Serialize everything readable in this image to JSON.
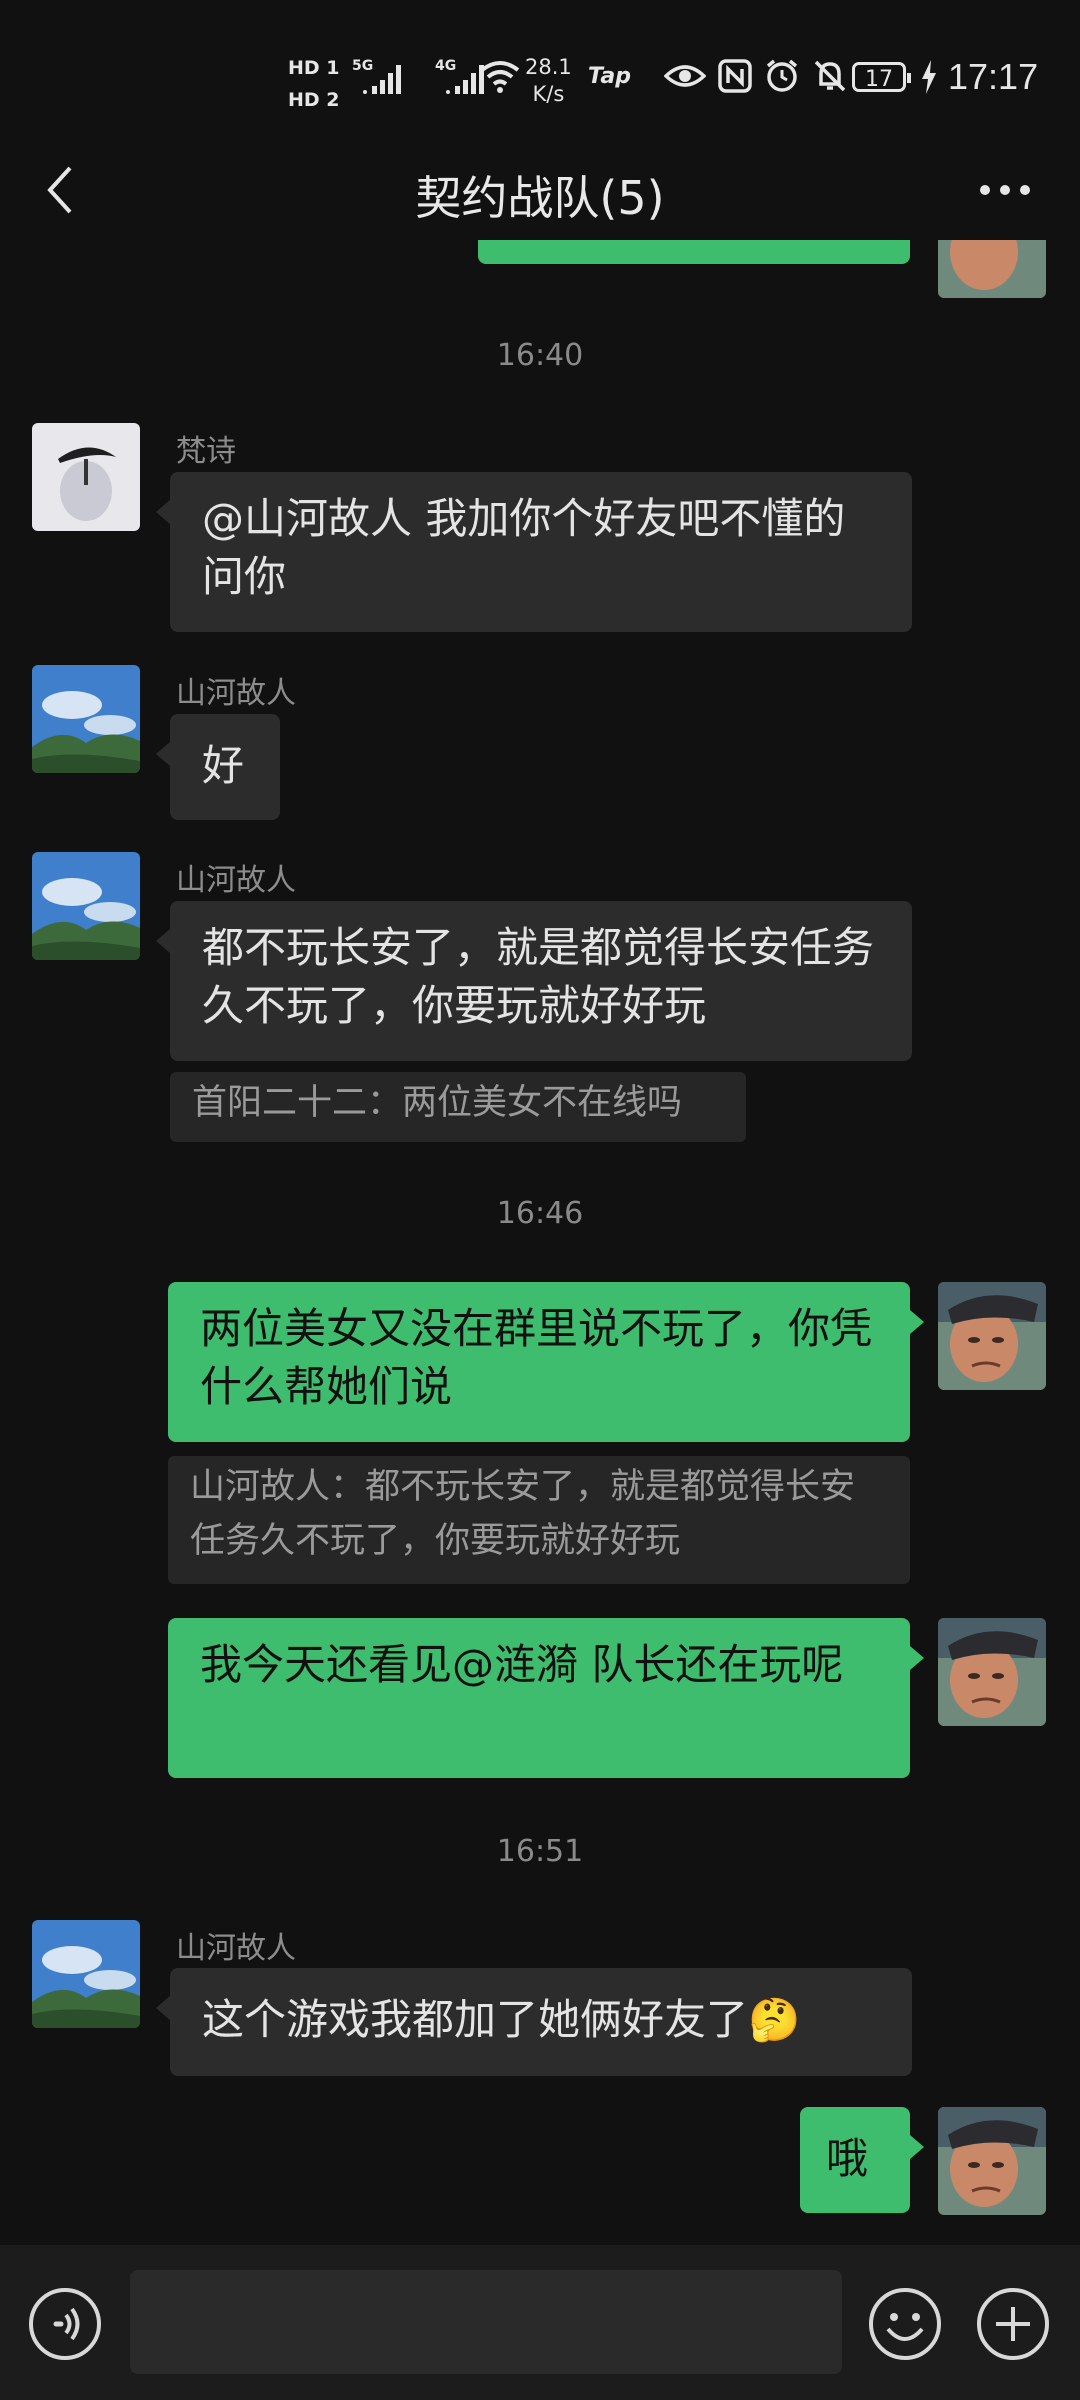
{
  "status_bar": {
    "hd1": "HD 1",
    "hd2": "HD 2",
    "sig1_label": "5G",
    "sig2_label": "4G",
    "net_speed_value": "28.1",
    "net_speed_unit": "K/s",
    "tap": "Tap",
    "battery": "17",
    "time": "17:17"
  },
  "header": {
    "title": "契约战队(5)"
  },
  "messages": {
    "ts1": "16:40",
    "m1": {
      "sender": "梵诗",
      "text": "@山河故人  我加你个好友吧不懂的问你"
    },
    "m2": {
      "sender": "山河故人",
      "text": "好"
    },
    "m3": {
      "sender": "山河故人",
      "text": "都不玩长安了，就是都觉得长安任务久不玩了，你要玩就好好玩",
      "quote": "首阳二十二：两位美女不在线吗"
    },
    "ts2": "16:46",
    "m4": {
      "text": "两位美女又没在群里说不玩了，你凭什么帮她们说",
      "quote": "山河故人：都不玩长安了，就是都觉得长安任务久不玩了，你要玩就好好玩"
    },
    "m5": {
      "text": "我今天还看见@涟漪  队长还在玩呢"
    },
    "ts3": "16:51",
    "m6": {
      "sender": "山河故人",
      "text": "这个游戏我都加了她俩好友了",
      "emoji": "🤔"
    },
    "m7": {
      "text": "哦"
    }
  },
  "colors": {
    "background": "#111111",
    "own_bubble": "#3fbd6e",
    "other_bubble": "#2c2c2c"
  },
  "icons": {
    "back": "chevron-left-icon",
    "more": "more-dots-icon",
    "voice": "voice-icon",
    "emoji": "emoji-icon",
    "plus": "plus-icon"
  }
}
